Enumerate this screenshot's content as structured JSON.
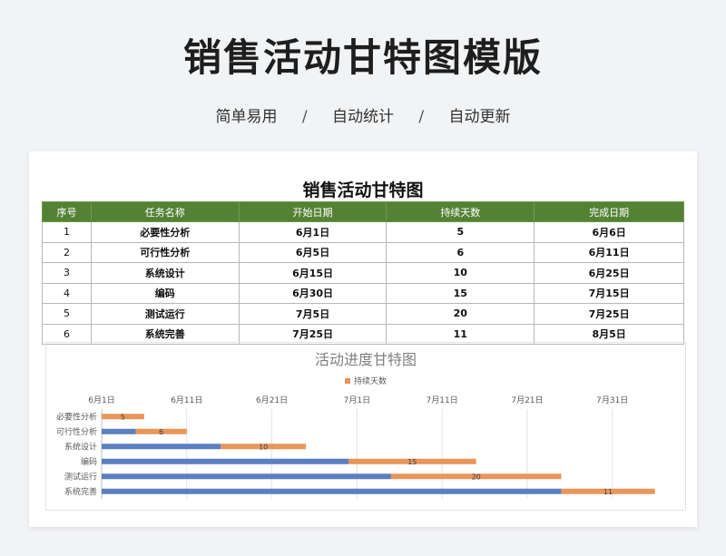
{
  "page": {
    "title": "销售活动甘特图模版",
    "subtitle_items": [
      "简单易用",
      "自动统计",
      "自动更新"
    ],
    "separator": "/"
  },
  "sheet": {
    "title": "销售活动甘特图",
    "headers": [
      "序号",
      "任务名称",
      "开始日期",
      "持续天数",
      "完成日期"
    ],
    "rows": [
      [
        "1",
        "必要性分析",
        "6月1日",
        "5",
        "6月6日"
      ],
      [
        "2",
        "可行性分析",
        "6月5日",
        "6",
        "6月11日"
      ],
      [
        "3",
        "系统设计",
        "6月15日",
        "10",
        "6月25日"
      ],
      [
        "4",
        "编码",
        "6月30日",
        "15",
        "7月15日"
      ],
      [
        "5",
        "测试运行",
        "7月5日",
        "20",
        "7月25日"
      ],
      [
        "6",
        "系统完善",
        "7月25日",
        "11",
        "8月5日"
      ]
    ]
  },
  "chart_data": {
    "type": "bar",
    "orientation": "horizontal-stacked",
    "title": "活动进度甘特图",
    "categories": [
      "必要性分析",
      "可行性分析",
      "系统设计",
      "编码",
      "测试运行",
      "系统完善"
    ],
    "series": [
      {
        "role": "start",
        "values": [
          "6月1日",
          "6月5日",
          "6月15日",
          "6月30日",
          "7月5日",
          "7月25日"
        ],
        "color": "#5b7fc0"
      },
      {
        "name": "持续天数",
        "values": [
          5,
          6,
          10,
          15,
          20,
          11
        ],
        "color": "#e8965a"
      }
    ],
    "x_ticks": [
      "6月1日",
      "6月11日",
      "6月21日",
      "7月1日",
      "7月11日",
      "7月21日",
      "7月31日"
    ],
    "xlim": [
      "6月1日",
      "8月6日"
    ],
    "legend": "top-center",
    "grid": true
  },
  "colors": {
    "header_green": "#548235",
    "bar_blue": "#5b7fc0",
    "bar_orange": "#e8965a"
  }
}
